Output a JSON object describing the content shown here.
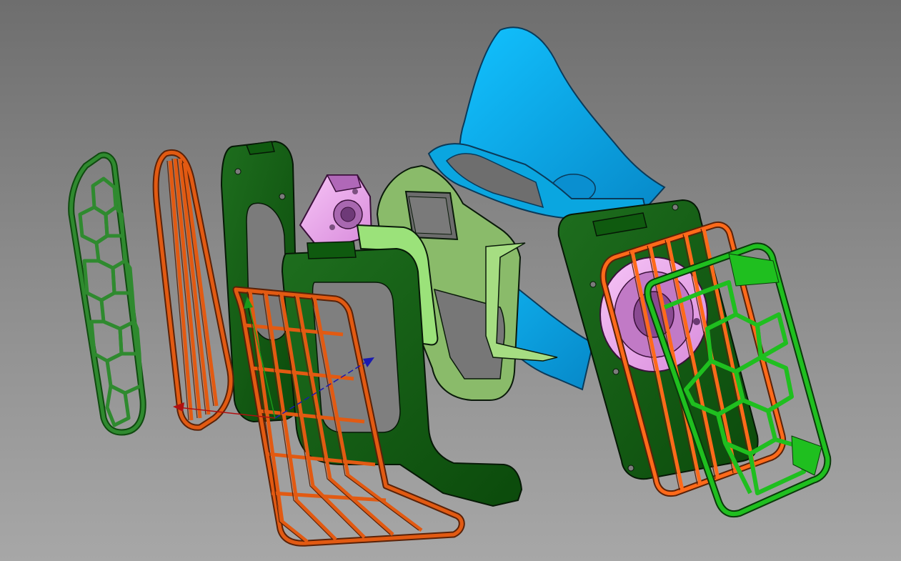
{
  "viewport": {
    "background_top": "#6e6e6e",
    "background_bottom": "#a7a7a7"
  },
  "colors": {
    "mask_blue": "#0aaee8",
    "mask_blue_dark": "#0a78b4",
    "frame_dark_green": "#0d4f0d",
    "frame_mid_green": "#1b6d1b",
    "light_green": "#8ee06e",
    "sage_green": "#86b968",
    "pink": "#f0a8f0",
    "pink_shadow": "#a060b0",
    "orange": "#e25a12",
    "orange_dark": "#8c3a0f",
    "hex_green": "#1fbf1f",
    "outline": "#0a1a0a",
    "axis_x": "#b01010",
    "axis_y": "#1a9a1a",
    "axis_z": "#1a1ab0"
  },
  "parts": [
    {
      "id": "face-mask",
      "color_key": "mask_blue"
    },
    {
      "id": "mask-adapter-plate",
      "color_key": "sage_green"
    },
    {
      "id": "left-filter-housing",
      "color_key": "frame_dark_green"
    },
    {
      "id": "left-inner-frame",
      "color_key": "frame_dark_green"
    },
    {
      "id": "left-fan-bracket",
      "color_key": "pink"
    },
    {
      "id": "left-elbow-duct",
      "color_key": "light_green"
    },
    {
      "id": "left-hex-grille",
      "color_key": "frame_mid_green"
    },
    {
      "id": "left-rear-orange-grille",
      "color_key": "orange"
    },
    {
      "id": "left-front-orange-grille",
      "color_key": "orange"
    },
    {
      "id": "right-filter-housing",
      "color_key": "frame_dark_green"
    },
    {
      "id": "right-fan",
      "color_key": "pink"
    },
    {
      "id": "right-orange-grille",
      "color_key": "orange"
    },
    {
      "id": "right-hex-grille",
      "color_key": "hex_green"
    }
  ]
}
